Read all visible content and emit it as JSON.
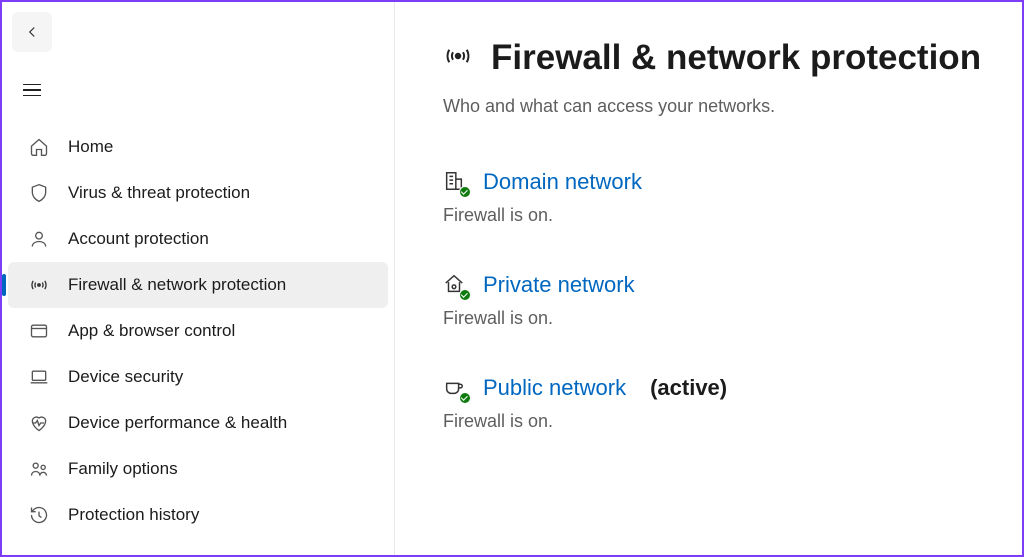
{
  "sidebar": {
    "items": [
      {
        "label": "Home",
        "icon": "home-icon"
      },
      {
        "label": "Virus & threat protection",
        "icon": "shield-icon"
      },
      {
        "label": "Account protection",
        "icon": "person-icon"
      },
      {
        "label": "Firewall & network protection",
        "icon": "antenna-icon"
      },
      {
        "label": "App & browser control",
        "icon": "app-icon"
      },
      {
        "label": "Device security",
        "icon": "laptop-icon"
      },
      {
        "label": "Device performance & health",
        "icon": "heart-icon"
      },
      {
        "label": "Family options",
        "icon": "family-icon"
      },
      {
        "label": "Protection history",
        "icon": "history-icon"
      }
    ],
    "selected_index": 3
  },
  "main": {
    "title": "Firewall & network protection",
    "subtitle": "Who and what can access your networks.",
    "networks": [
      {
        "label": "Domain network",
        "status": "Firewall is on.",
        "active": false
      },
      {
        "label": "Private network",
        "status": "Firewall is on.",
        "active": false
      },
      {
        "label": "Public network",
        "status": "Firewall is on.",
        "active": true
      }
    ],
    "active_suffix": "(active)"
  },
  "colors": {
    "accent": "#0067c0",
    "annotation_arrow": "#7d3cf8"
  }
}
